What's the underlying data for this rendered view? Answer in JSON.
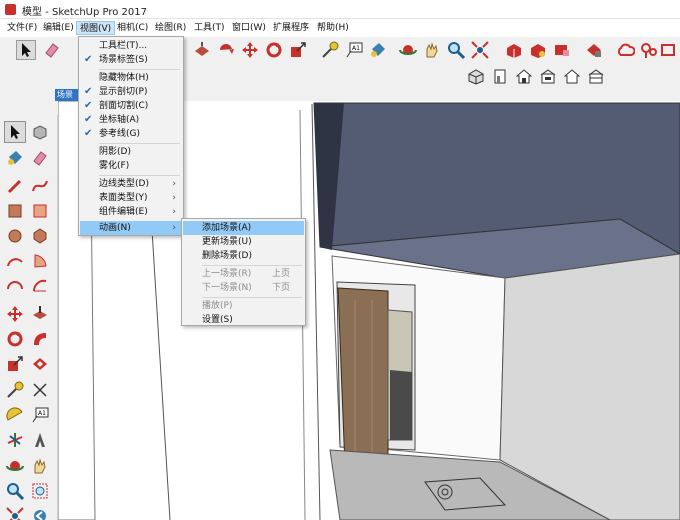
{
  "window": {
    "title": "模型 - SketchUp Pro 2017"
  },
  "menubar": [
    {
      "key": "file",
      "label": "文件(F)"
    },
    {
      "key": "edit",
      "label": "编辑(E)"
    },
    {
      "key": "view",
      "label": "视图(V)",
      "active": true
    },
    {
      "key": "camera",
      "label": "相机(C)"
    },
    {
      "key": "draw",
      "label": "绘图(R)"
    },
    {
      "key": "tools",
      "label": "工具(T)"
    },
    {
      "key": "window",
      "label": "窗口(W)"
    },
    {
      "key": "extensions",
      "label": "扩展程序"
    },
    {
      "key": "help",
      "label": "帮助(H)"
    }
  ],
  "scene_tab": {
    "label": "场景"
  },
  "view_menu": {
    "items": [
      {
        "label": "工具栏(T)...",
        "checked": false
      },
      {
        "label": "场景标签(S)",
        "checked": true
      },
      {
        "separator": true
      },
      {
        "label": "隐藏物体(H)",
        "checked": false
      },
      {
        "label": "显示剖切(P)",
        "checked": true
      },
      {
        "label": "剖面切割(C)",
        "checked": true
      },
      {
        "label": "坐标轴(A)",
        "checked": true
      },
      {
        "label": "参考线(G)",
        "checked": true
      },
      {
        "separator": true
      },
      {
        "label": "阴影(D)",
        "checked": false
      },
      {
        "label": "雾化(F)",
        "checked": false
      },
      {
        "separator": true
      },
      {
        "label": "边线类型(D)",
        "submenu": true
      },
      {
        "label": "表面类型(Y)",
        "submenu": true
      },
      {
        "label": "组件编辑(E)",
        "submenu": true
      },
      {
        "separator": true
      },
      {
        "label": "动画(N)",
        "submenu": true,
        "highlighted": true
      }
    ]
  },
  "animation_menu": {
    "items": [
      {
        "label": "添加场景(A)",
        "highlighted": true
      },
      {
        "label": "更新场景(U)"
      },
      {
        "label": "删除场景(D)"
      },
      {
        "separator": true
      },
      {
        "label": "上一场景(R)",
        "shortcut": "上页",
        "disabled": true
      },
      {
        "label": "下一场景(N)",
        "shortcut": "下页",
        "disabled": true
      },
      {
        "separator": true
      },
      {
        "label": "播放(P)",
        "disabled": true
      },
      {
        "label": "设置(S)"
      }
    ]
  },
  "toolbar_icons": [
    "select-arrow-icon",
    "eraser-icon",
    "cut-3d-icon",
    "rotate-red-icon",
    "move-arrows-icon",
    "redo-circle-icon",
    "scale-icon",
    "tape-measure-icon",
    "text-label-icon",
    "paint-bucket-icon",
    "orbit-icon",
    "pan-hand-icon",
    "zoom-icon",
    "zoom-extents-icon",
    "warehouse-3d-icon",
    "share-model-icon",
    "extension-warehouse-icon",
    "layout-icon",
    "components-icon",
    "cloud-icon",
    "location-icon",
    "account-icon"
  ],
  "view_icons": [
    "iso-view-icon",
    "front-view-icon",
    "top-view-icon",
    "right-view-icon",
    "back-view-icon",
    "left-view-icon"
  ],
  "left_tools": [
    "select-arrow-icon",
    "make-component-icon",
    "paint-bucket-icon",
    "eraser-icon",
    "pencil-line-icon",
    "freehand-arc-icon",
    "rectangle-icon",
    "rotated-rect-icon",
    "circle-icon",
    "polygon-icon",
    "arc-icon",
    "pie-arc-icon",
    "two-point-arc-icon",
    "three-point-arc-icon",
    "move-icon",
    "push-pull-icon",
    "rotate-icon",
    "follow-me-icon",
    "scale-icon",
    "offset-icon",
    "tape-measure-icon",
    "dimension-icon",
    "protractor-icon",
    "text-icon",
    "axes-icon",
    "3d-text-icon",
    "orbit-icon",
    "pan-icon",
    "zoom-icon",
    "zoom-window-icon",
    "zoom-extents-icon",
    "previous-view-icon"
  ]
}
